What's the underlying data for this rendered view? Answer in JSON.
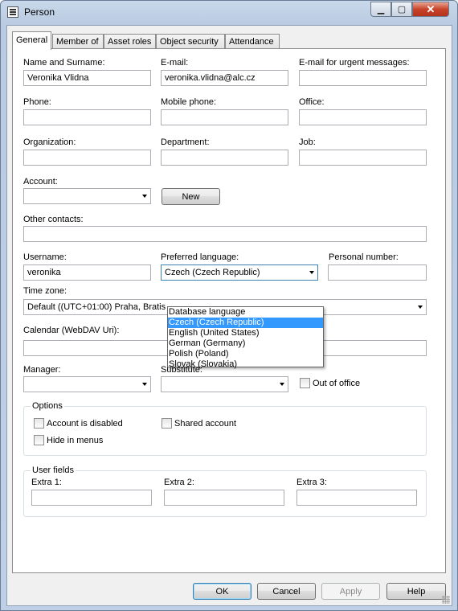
{
  "window": {
    "title": "Person"
  },
  "tabs": [
    "General",
    "Member of",
    "Asset roles",
    "Object security",
    "Attendance"
  ],
  "fields": {
    "name_label": "Name and Surname:",
    "name_value": "Veronika Vlidna",
    "email_label": "E-mail:",
    "email_value": "veronika.vlidna@alc.cz",
    "urgent_email_label": "E-mail for urgent messages:",
    "urgent_email_value": "",
    "phone_label": "Phone:",
    "phone_value": "",
    "mobile_label": "Mobile phone:",
    "mobile_value": "",
    "office_label": "Office:",
    "office_value": "",
    "organization_label": "Organization:",
    "organization_value": "",
    "department_label": "Department:",
    "department_value": "",
    "job_label": "Job:",
    "job_value": "",
    "account_label": "Account:",
    "account_value": "",
    "new_button": "New",
    "other_contacts_label": "Other contacts:",
    "other_contacts_value": "",
    "username_label": "Username:",
    "username_value": "veronika",
    "language_label": "Preferred language:",
    "language_value": "Czech (Czech Republic)",
    "personal_number_label": "Personal number:",
    "personal_number_value": "",
    "timezone_label": "Time zone:",
    "timezone_value": "Default ((UTC+01:00) Praha, Bratis",
    "calendar_label": "Calendar (WebDAV Uri):",
    "calendar_value": "",
    "manager_label": "Manager:",
    "manager_value": "",
    "substitute_label": "Substitute:",
    "substitute_value": "",
    "out_of_office_label": "Out of office"
  },
  "language_options": [
    "Database language",
    "Czech (Czech Republic)",
    "English (United States)",
    "German (Germany)",
    "Polish (Poland)",
    "Slovak (Slovakia)"
  ],
  "language_selected_index": 1,
  "options": {
    "title": "Options",
    "account_disabled": "Account is disabled",
    "shared_account": "Shared account",
    "hide_in_menus": "Hide in menus"
  },
  "user_fields": {
    "title": "User fields",
    "extra1_label": "Extra 1:",
    "extra2_label": "Extra 2:",
    "extra3_label": "Extra 3:"
  },
  "buttons": {
    "ok": "OK",
    "cancel": "Cancel",
    "apply": "Apply",
    "help": "Help"
  },
  "colors": {
    "selection": "#3399ff",
    "title_bar": "#c9d8ea",
    "close_button": "#c7442b"
  }
}
